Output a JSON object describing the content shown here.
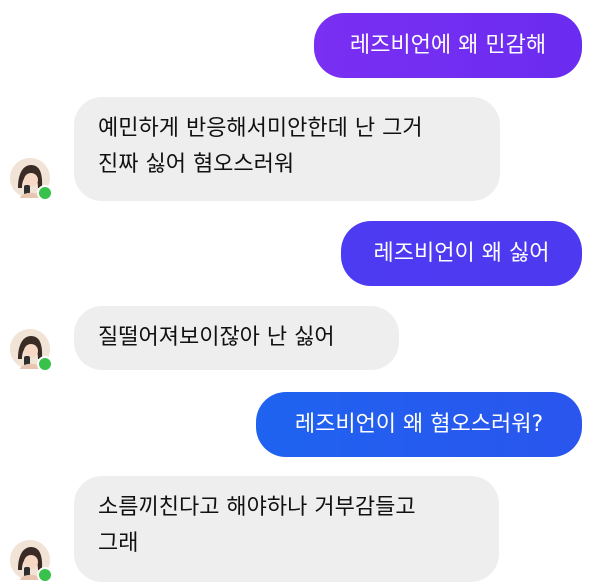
{
  "messages": [
    {
      "id": "m1",
      "side": "sent",
      "lines": [
        "레즈비언에 왜 민감해"
      ]
    },
    {
      "id": "m2",
      "side": "received",
      "lines": [
        "예민하게 반응해서미안한데 난 그거",
        "진짜 싫어 혐오스러워"
      ]
    },
    {
      "id": "m3",
      "side": "sent",
      "lines": [
        "레즈비언이 왜 싫어"
      ]
    },
    {
      "id": "m4",
      "side": "received",
      "lines": [
        "질떨어져보이잖아 난 싫어"
      ]
    },
    {
      "id": "m5",
      "side": "sent",
      "lines": [
        "레즈비언이 왜 혐오스러워?"
      ]
    },
    {
      "id": "m6",
      "side": "received",
      "lines": [
        "소름끼친다고 해야하나 거부감들고",
        "그래"
      ]
    }
  ],
  "avatar": {
    "icon": "profile-avatar-icon",
    "status": "online"
  },
  "colors": {
    "sent_1": "#7a2ff2",
    "sent_2": "#4d3bf3",
    "sent_3": "#2a55ee",
    "received_bg": "#eeeeee",
    "online": "#39c24b"
  }
}
